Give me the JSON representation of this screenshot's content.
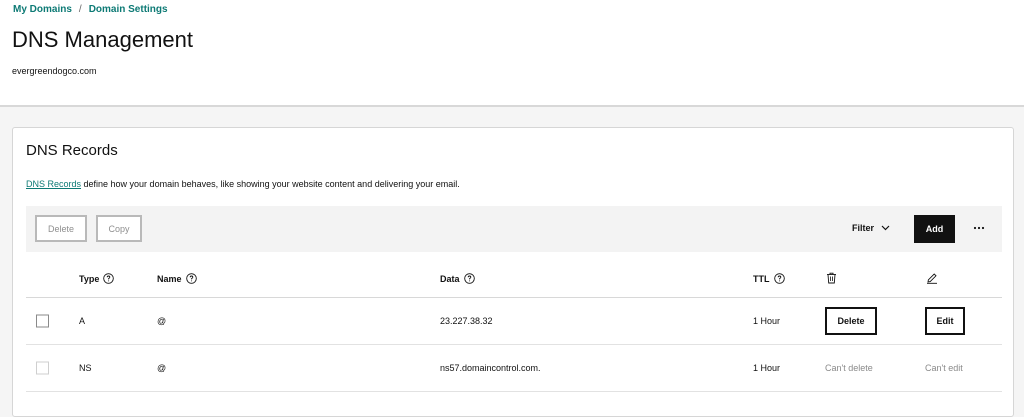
{
  "breadcrumb": {
    "items": [
      "My Domains",
      "Domain Settings"
    ],
    "separator": "/"
  },
  "header": {
    "title": "DNS Management",
    "domain": "evergreendogco.com"
  },
  "card": {
    "title": "DNS Records",
    "description_link": "DNS Records",
    "description_rest": " define how your domain behaves, like showing your website content and delivering your email."
  },
  "toolbar": {
    "delete_label": "Delete",
    "copy_label": "Copy",
    "filter_label": "Filter",
    "add_label": "Add",
    "more_icon": "ellipsis-icon"
  },
  "table": {
    "columns": {
      "type": "Type",
      "name": "Name",
      "data": "Data",
      "ttl": "TTL"
    },
    "column_icons": {
      "delete": "trash-icon",
      "edit": "pencil-icon"
    },
    "rows": [
      {
        "type": "A",
        "name": "@",
        "data": "23.227.38.32",
        "ttl": "1 Hour",
        "delete_label": "Delete",
        "edit_label": "Edit",
        "editable": true
      },
      {
        "type": "NS",
        "name": "@",
        "data": "ns57.domaincontrol.com.",
        "ttl": "1 Hour",
        "delete_label": "Can't delete",
        "edit_label": "Can't edit",
        "editable": false
      }
    ]
  },
  "colors": {
    "link": "#0d7a75",
    "primary_button": "#111111",
    "muted_text": "#8a8a8a"
  }
}
